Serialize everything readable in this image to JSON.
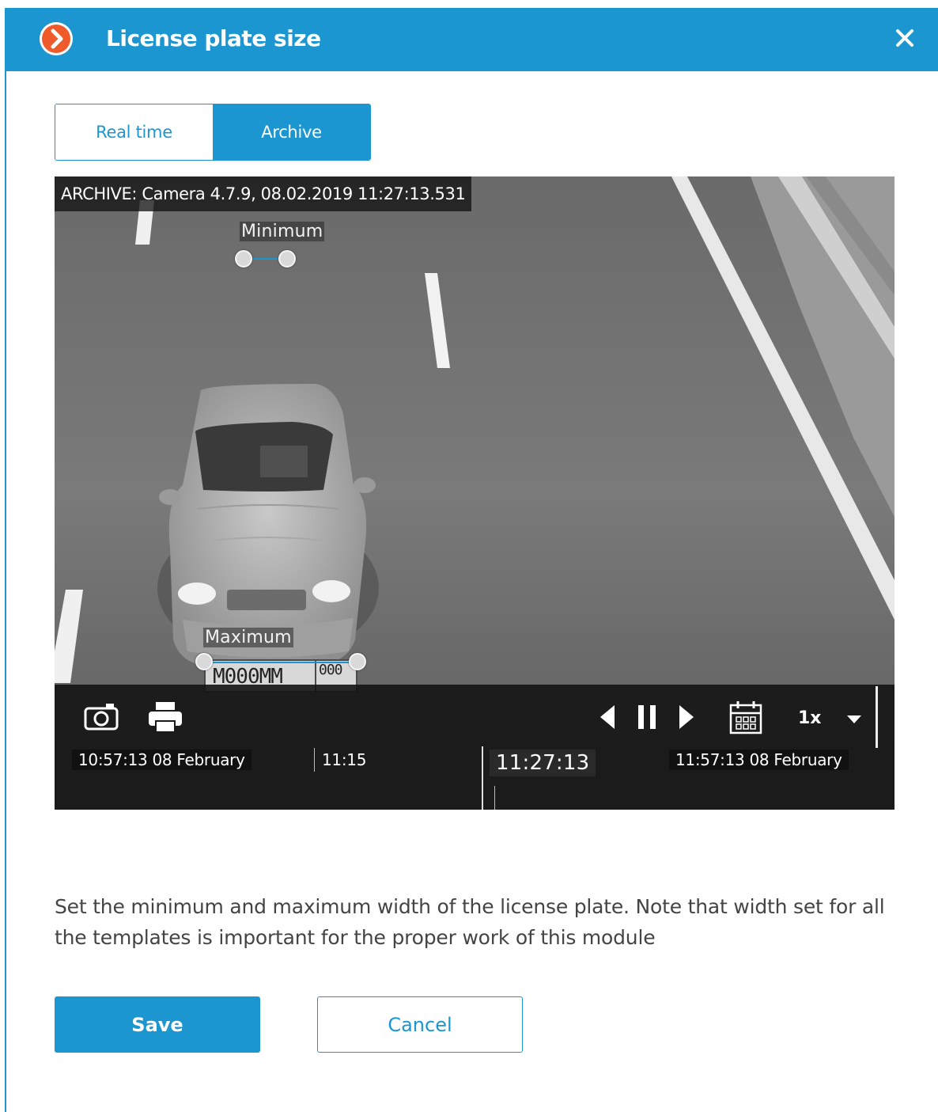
{
  "dialog": {
    "title": "License plate size",
    "colors": {
      "accent": "#1b96d1",
      "logo": "#ee5a2a"
    }
  },
  "mode_tabs": [
    {
      "label": "Real time",
      "selected": false
    },
    {
      "label": "Archive",
      "selected": true
    }
  ],
  "video": {
    "osd_text": "ARCHIVE: Camera 4.7.9, 08.02.2019 11:27:13.531",
    "min_label": "Minimum",
    "max_label": "Maximum",
    "plate_text": "M000MM",
    "plate_region": "000"
  },
  "playback": {
    "icons": [
      "camera-snapshot-icon",
      "print-icon",
      "step-back-icon",
      "pause-icon",
      "play-icon",
      "calendar-icon",
      "chevron-down-icon"
    ],
    "speed": "1x",
    "start_time": "10:57:13 08 February",
    "tick_label": "11:15",
    "current_time": "11:27:13",
    "end_time": "11:57:13 08 February"
  },
  "hint": "Set the minimum and maximum width of the license plate. Note that width set for all the templates is important for the proper work of this module",
  "buttons": {
    "save": "Save",
    "cancel": "Cancel"
  }
}
